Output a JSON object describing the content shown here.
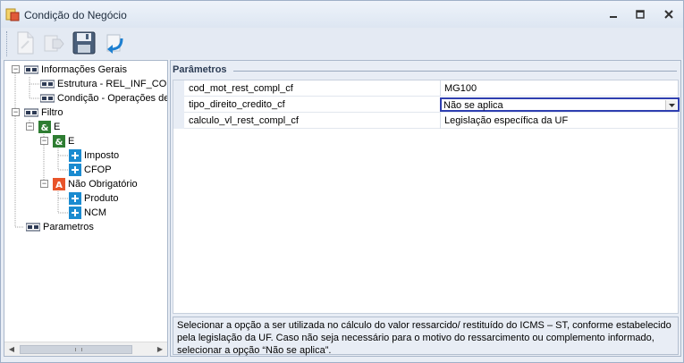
{
  "window": {
    "title": "Condição do Negócio",
    "controls": [
      "minimize-icon",
      "maximize-icon",
      "close-icon"
    ]
  },
  "toolbar": {
    "buttons": [
      {
        "name": "new-document",
        "icon": "new-document-icon",
        "enabled": false
      },
      {
        "name": "forward",
        "icon": "arrow-forward-icon",
        "enabled": false
      },
      {
        "name": "save",
        "icon": "floppy-disk-icon",
        "enabled": true
      },
      {
        "name": "undo",
        "icon": "undo-arrow-icon",
        "enabled": true
      }
    ]
  },
  "tree": {
    "nodes": [
      {
        "label": "Informações Gerais",
        "icon": "form-icon",
        "expanded": true
      },
      {
        "label": "Estrutura - REL_INF_CO",
        "icon": "form-icon"
      },
      {
        "label": "Condição - Operações de",
        "icon": "form-icon"
      },
      {
        "label": "Filtro",
        "icon": "form-icon",
        "expanded": true
      },
      {
        "label": "E",
        "icon": "and-icon",
        "expanded": true
      },
      {
        "label": "E",
        "icon": "and-icon",
        "expanded": true
      },
      {
        "label": "Imposto",
        "icon": "plus-box-icon"
      },
      {
        "label": "CFOP",
        "icon": "plus-box-icon"
      },
      {
        "label": "Não Obrigatório",
        "icon": "optional-a-icon",
        "expanded": true
      },
      {
        "label": "Produto",
        "icon": "plus-box-icon"
      },
      {
        "label": "NCM",
        "icon": "plus-box-icon"
      },
      {
        "label": "Parametros",
        "icon": "form-icon"
      }
    ]
  },
  "properties": {
    "header": "Parâmetros",
    "rows": [
      {
        "name": "cod_mot_rest_compl_cf",
        "value": "MG100"
      },
      {
        "name": "tipo_direito_credito_cf",
        "value": "Não se aplica"
      },
      {
        "name": "calculo_vl_rest_compl_cf",
        "value": "Legislação específica da UF"
      }
    ],
    "selected_row": 1,
    "description": "Selecionar a opção a ser utilizada no cálculo do valor ressarcido/ restituído do ICMS – ST, conforme estabelecido pela legislação da UF. Caso não seja necessário para o motivo do ressarcimento ou complemento informado, selecionar a opção “Não se aplica”."
  },
  "colors": {
    "selection_border": "#2f3fb0",
    "and_icon": "#2e7d32",
    "plus_icon": "#1a8bd0",
    "optional_icon": "#e8542a"
  }
}
